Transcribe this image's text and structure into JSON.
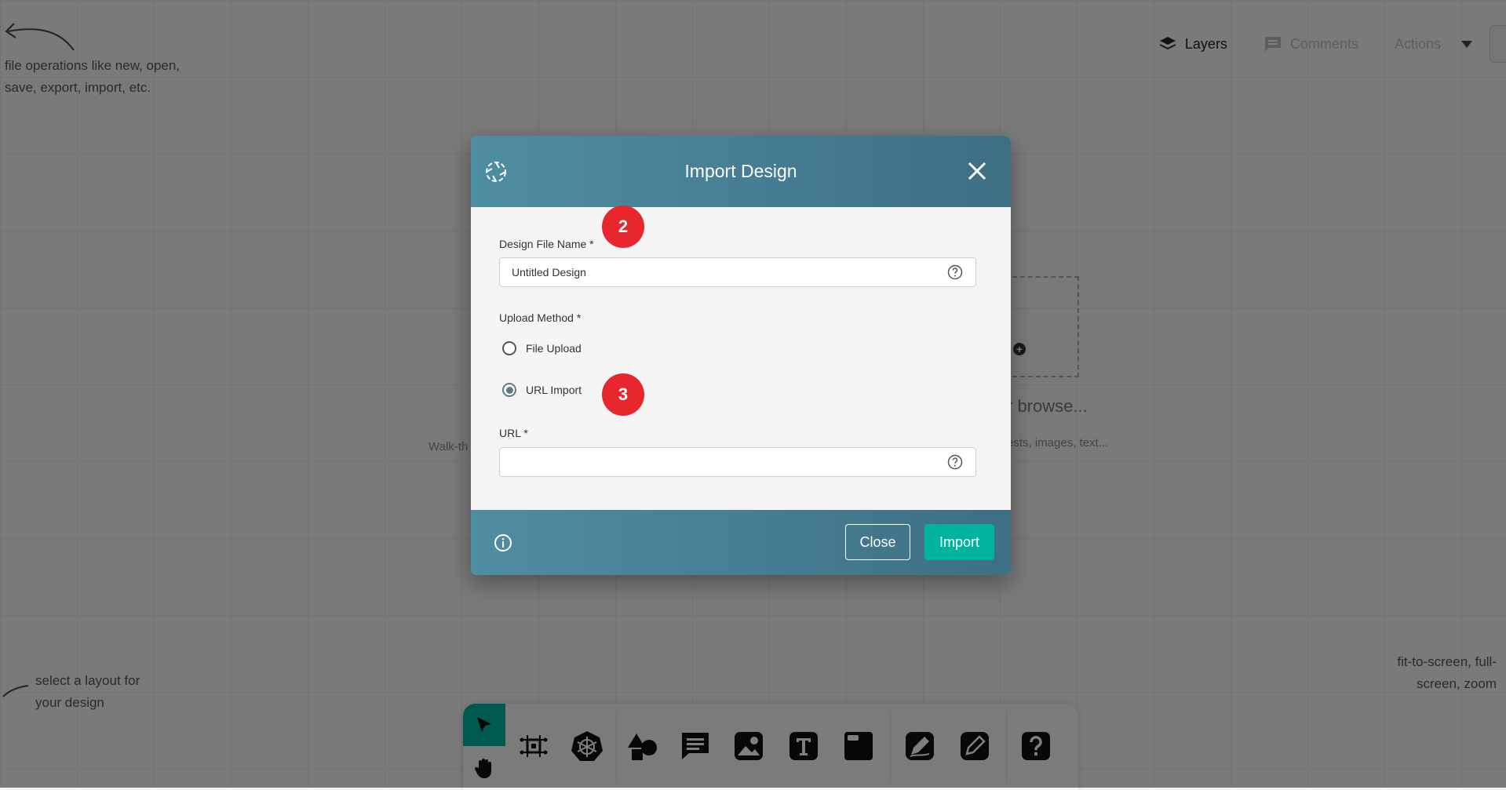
{
  "hints": {
    "file_ops": "file operations like new, open, save, export, import, etc.",
    "layout": "select a layout for your design",
    "zoom": "fit-to-screen, full-screen, zoom",
    "walk": "Walk-th",
    "browse": "r browse...",
    "browse_sub": "ests, images, text..."
  },
  "topbar": {
    "layers": "Layers",
    "comments": "Comments",
    "actions": "Actions"
  },
  "modal": {
    "title": "Import Design",
    "design_file_label": "Design File Name *",
    "design_file_value": "Untitled Design",
    "upload_method_label": "Upload Method *",
    "option_file_upload": "File Upload",
    "option_url_import": "URL Import",
    "selected_method": "URL Import",
    "url_label": "URL *",
    "url_value": "",
    "close_label": "Close",
    "import_label": "Import"
  },
  "badges": {
    "step_2": "2",
    "step_3": "3"
  },
  "colors": {
    "accent": "#00b39f",
    "header": "#477f95",
    "badge": "#e8262d"
  },
  "icons": [
    "layers-icon",
    "comment-icon",
    "chevron-down-icon",
    "app-logo-icon",
    "close-icon",
    "help-icon",
    "info-icon",
    "pointer-icon",
    "hand-icon",
    "component-icon",
    "kubernetes-icon",
    "shapes-icon",
    "comment-icon",
    "image-icon",
    "text-icon",
    "section-icon",
    "pen-icon",
    "pencil-icon",
    "help-icon"
  ]
}
